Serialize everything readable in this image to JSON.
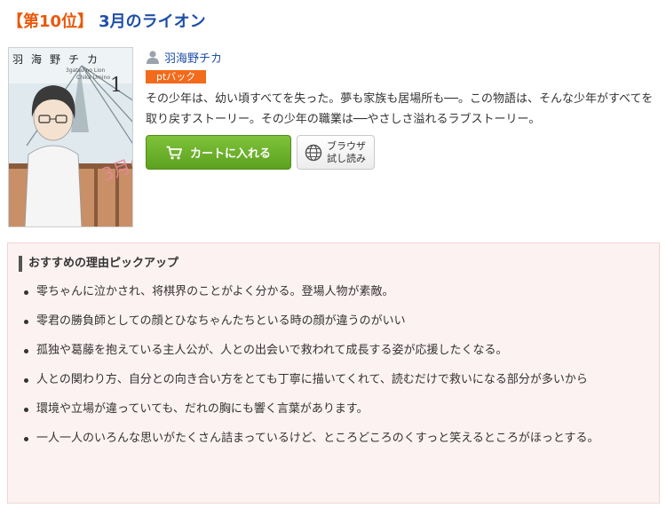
{
  "heading": {
    "rank": "【第10位】",
    "title": "3月のライオン"
  },
  "cover": {
    "author_vertical": "羽海野チカ",
    "romaji_line1": "3gatsu no Lion",
    "romaji_line2": "Chika Umino",
    "volume": "1",
    "title_art": "3月のライオン"
  },
  "author": {
    "name": "羽海野チカ",
    "icon": "person-icon"
  },
  "badge": "ptバック",
  "description": "その少年は、幼い頃すべてを失った。夢も家族も居場所も──。この物語は、そんな少年がすべてを取り戻すストーリー。その少年の職業は──やさしさ溢れるラブストーリー。",
  "actions": {
    "cart_label": "カートに入れる",
    "cart_icon": "cart-icon",
    "browse_line1": "ブラウザ",
    "browse_line2": "試し読み",
    "browse_icon": "globe-icon"
  },
  "reasons": {
    "title": "おすすめの理由ピックアップ",
    "items": [
      "零ちゃんに泣かされ、将棋界のことがよく分かる。登場人物が素敵。",
      "零君の勝負師としての顔とひなちゃんたちといる時の顔が違うのがいい",
      "孤独や葛藤を抱えている主人公が、人との出会いで救われて成長する姿が応援したくなる。",
      "人との関わり方、自分との向き合い方をとても丁寧に描いてくれて、読むだけで救いになる部分が多いから",
      "環境や立場が違っていても、だれの胸にも響く言葉があります。",
      "一人一人のいろんな思いがたくさん詰まっているけど、ところどころのくすっと笑えるところがほっとする。"
    ]
  },
  "colors": {
    "rank": "#e8590c",
    "title": "#1f4fa8",
    "badge": "#f26a1b",
    "cart": "#6cb12b",
    "reasons_bg": "#fdf2f2"
  }
}
